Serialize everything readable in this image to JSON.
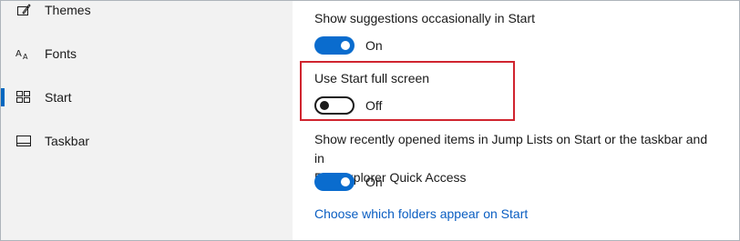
{
  "sidebar": {
    "items": [
      {
        "label": "Themes",
        "icon": "themes-icon",
        "selected": false
      },
      {
        "label": "Fonts",
        "icon": "fonts-icon",
        "selected": false
      },
      {
        "label": "Start",
        "icon": "start-icon",
        "selected": true
      },
      {
        "label": "Taskbar",
        "icon": "taskbar-icon",
        "selected": false
      }
    ]
  },
  "settings": {
    "suggestions": {
      "label": "Show suggestions occasionally in Start",
      "state": "On",
      "value": true
    },
    "full_screen": {
      "label": "Use Start full screen",
      "state": "Off",
      "value": false
    },
    "jump_lists": {
      "label_line1": "Show recently opened items in Jump Lists on Start or the taskbar and in",
      "label_line2": "File Explorer Quick Access",
      "state": "On",
      "value": true
    }
  },
  "link": {
    "label": "Choose which folders appear on Start"
  },
  "colors": {
    "accent": "#0067c0",
    "toggle_on": "#0a6cce",
    "highlight": "#d0242f",
    "link": "#0a5ec2",
    "sidebar_bg": "#f2f2f2"
  }
}
